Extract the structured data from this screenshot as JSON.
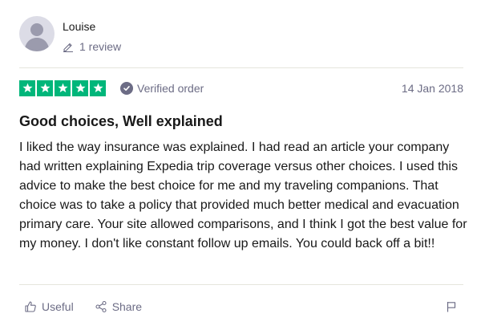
{
  "reviewer": {
    "name": "Louise",
    "review_count": "1 review",
    "avatar_icon": "user-avatar-icon",
    "review_count_icon": "pencil-icon"
  },
  "review": {
    "rating": 5,
    "max_rating": 5,
    "verified_label": "Verified order",
    "date": "14 Jan 2018",
    "title": "Good choices, Well explained",
    "body": "I liked the way insurance was explained. I had read an article your company had written explaining Expedia trip coverage versus other choices. I used this advice to make the best choice for me and my traveling companions. That choice was to take a policy that provided much better medical and evacuation primary care. Your site allowed comparisons, and I think I got the best value for my money. I don't like constant follow up emails. You could back off a bit!!"
  },
  "actions": {
    "useful_label": "Useful",
    "share_label": "Share",
    "useful_icon": "thumbs-up-icon",
    "share_icon": "share-icon",
    "flag_icon": "flag-icon"
  },
  "colors": {
    "star_green": "#00b67a",
    "muted_text": "#6c6c85",
    "divider": "#e5e5dd"
  }
}
